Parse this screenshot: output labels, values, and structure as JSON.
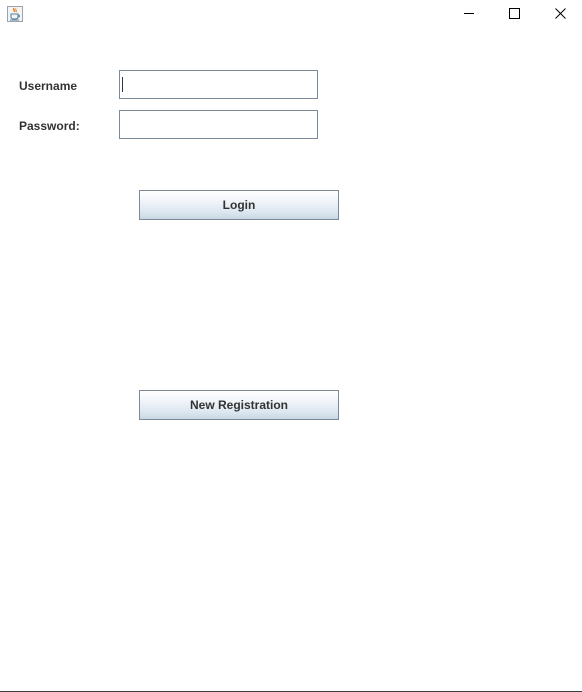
{
  "window": {
    "icon": "java-cup-icon",
    "controls": {
      "minimize_icon": "minimize-icon",
      "maximize_icon": "maximize-icon",
      "close_icon": "close-icon"
    }
  },
  "form": {
    "username_label": "Username",
    "username_value": "",
    "password_label": "Password:",
    "password_value": ""
  },
  "buttons": {
    "login_label": "Login",
    "register_label": "New Registration"
  },
  "colors": {
    "accent_border": "#7a8a99",
    "text": "#333333",
    "java_orange": "#e76f00",
    "java_blue": "#5382a1"
  }
}
